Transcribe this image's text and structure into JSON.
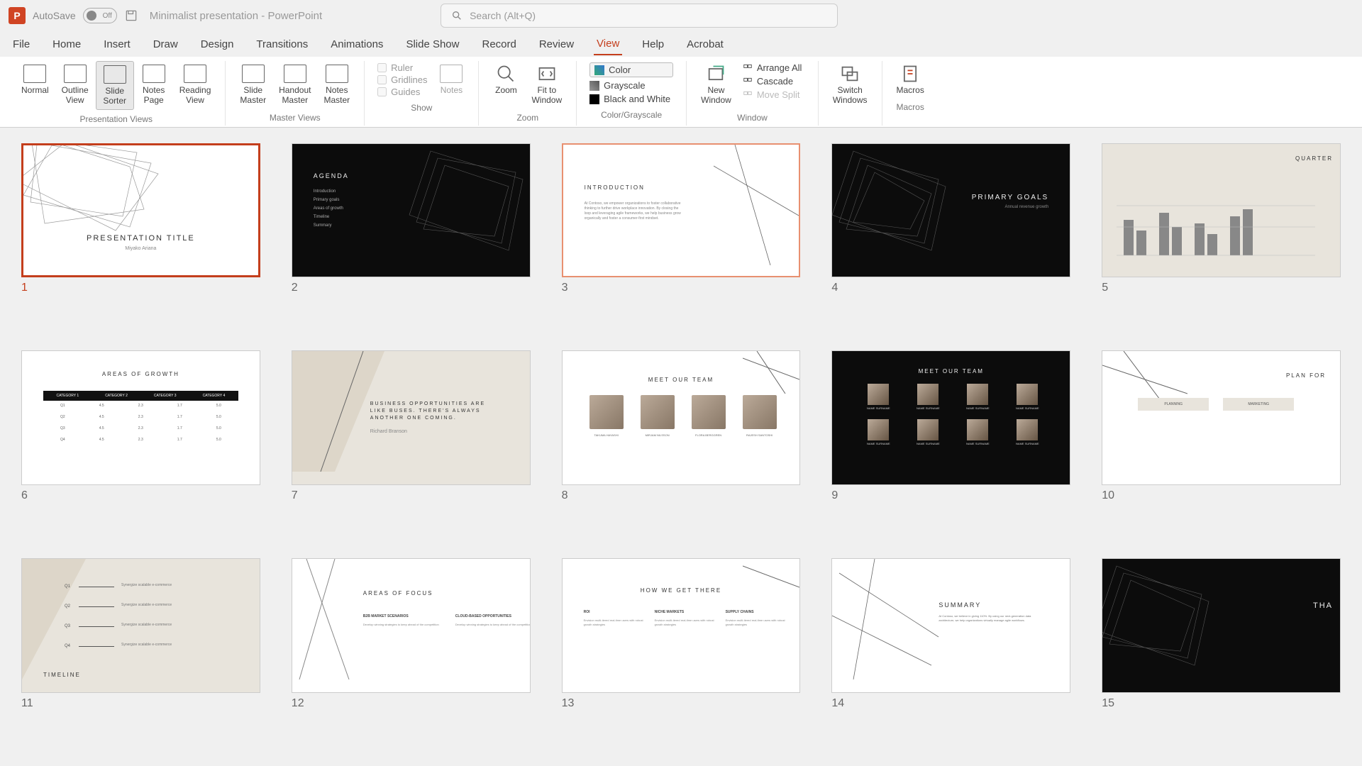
{
  "titlebar": {
    "autosave_label": "AutoSave",
    "autosave_state": "Off",
    "doc_title": "Minimalist presentation  -  PowerPoint",
    "search_placeholder": "Search (Alt+Q)"
  },
  "tabs": [
    "File",
    "Home",
    "Insert",
    "Draw",
    "Design",
    "Transitions",
    "Animations",
    "Slide Show",
    "Record",
    "Review",
    "View",
    "Help",
    "Acrobat"
  ],
  "active_tab": "View",
  "ribbon": {
    "presentation_views": {
      "label": "Presentation Views",
      "buttons": [
        {
          "label": "Normal"
        },
        {
          "label": "Outline\nView"
        },
        {
          "label": "Slide\nSorter",
          "active": true
        },
        {
          "label": "Notes\nPage"
        },
        {
          "label": "Reading\nView"
        }
      ]
    },
    "master_views": {
      "label": "Master Views",
      "buttons": [
        {
          "label": "Slide\nMaster"
        },
        {
          "label": "Handout\nMaster"
        },
        {
          "label": "Notes\nMaster"
        }
      ]
    },
    "show": {
      "label": "Show",
      "checks": [
        "Ruler",
        "Gridlines",
        "Guides"
      ],
      "notes_btn": "Notes"
    },
    "zoom": {
      "label": "Zoom",
      "zoom_btn": "Zoom",
      "fit_btn": "Fit to\nWindow"
    },
    "color_grayscale": {
      "label": "Color/Grayscale",
      "items": [
        "Color",
        "Grayscale",
        "Black and White"
      ]
    },
    "window": {
      "label": "Window",
      "new_window": "New\nWindow",
      "items": [
        "Arrange All",
        "Cascade",
        "Move Split"
      ]
    },
    "switch_windows": "Switch\nWindows",
    "macros": {
      "label": "Macros",
      "btn": "Macros"
    }
  },
  "slides": [
    {
      "num": "1",
      "title": "PRESENTATION TITLE",
      "sub": "Miyako Ariana",
      "bg": "white",
      "selected": true
    },
    {
      "num": "2",
      "title": "AGENDA",
      "bg": "dark",
      "items": [
        "Introduction",
        "Primary goals",
        "Areas of growth",
        "Timeline",
        "Summary"
      ]
    },
    {
      "num": "3",
      "title": "INTRODUCTION",
      "bg": "white",
      "highlight": true
    },
    {
      "num": "4",
      "title": "PRIMARY GOALS",
      "sub": "Annual revenue growth",
      "bg": "dark"
    },
    {
      "num": "5",
      "title": "QUARTER",
      "bg": "beige",
      "chart": true
    },
    {
      "num": "6",
      "title": "AREAS OF GROWTH",
      "bg": "white",
      "table": true,
      "cols": [
        "CATEGORY 1",
        "CATEGORY 2",
        "CATEGORY 3",
        "CATEGORY 4"
      ]
    },
    {
      "num": "7",
      "title": "BUSINESS OPPORTUNITIES ARE LIKE BUSES. THERE'S ALWAYS ANOTHER ONE COMING.",
      "sub": "Richard Branson",
      "bg": "beige"
    },
    {
      "num": "8",
      "title": "MEET OUR TEAM",
      "bg": "white",
      "team4": true
    },
    {
      "num": "9",
      "title": "MEET OUR TEAM",
      "bg": "dark",
      "team8": true
    },
    {
      "num": "10",
      "title": "PLAN FOR",
      "bg": "white",
      "cols2": [
        "PLANNING",
        "MARKETING"
      ]
    },
    {
      "num": "11",
      "title": "TIMELINE",
      "bg": "beige",
      "timeline": true,
      "quarters": [
        "Q1",
        "Q2",
        "Q3",
        "Q4"
      ]
    },
    {
      "num": "12",
      "title": "AREAS OF FOCUS",
      "bg": "white",
      "cols2": [
        "B2B MARKET SCENARIOS",
        "CLOUD-BASED OPPORTUNITIES"
      ]
    },
    {
      "num": "13",
      "title": "HOW WE GET THERE",
      "bg": "white",
      "cols3": [
        "ROI",
        "NICHE MARKETS",
        "SUPPLY CHAINS"
      ]
    },
    {
      "num": "14",
      "title": "SUMMARY",
      "bg": "white"
    },
    {
      "num": "15",
      "title": "THA",
      "bg": "dark"
    }
  ]
}
